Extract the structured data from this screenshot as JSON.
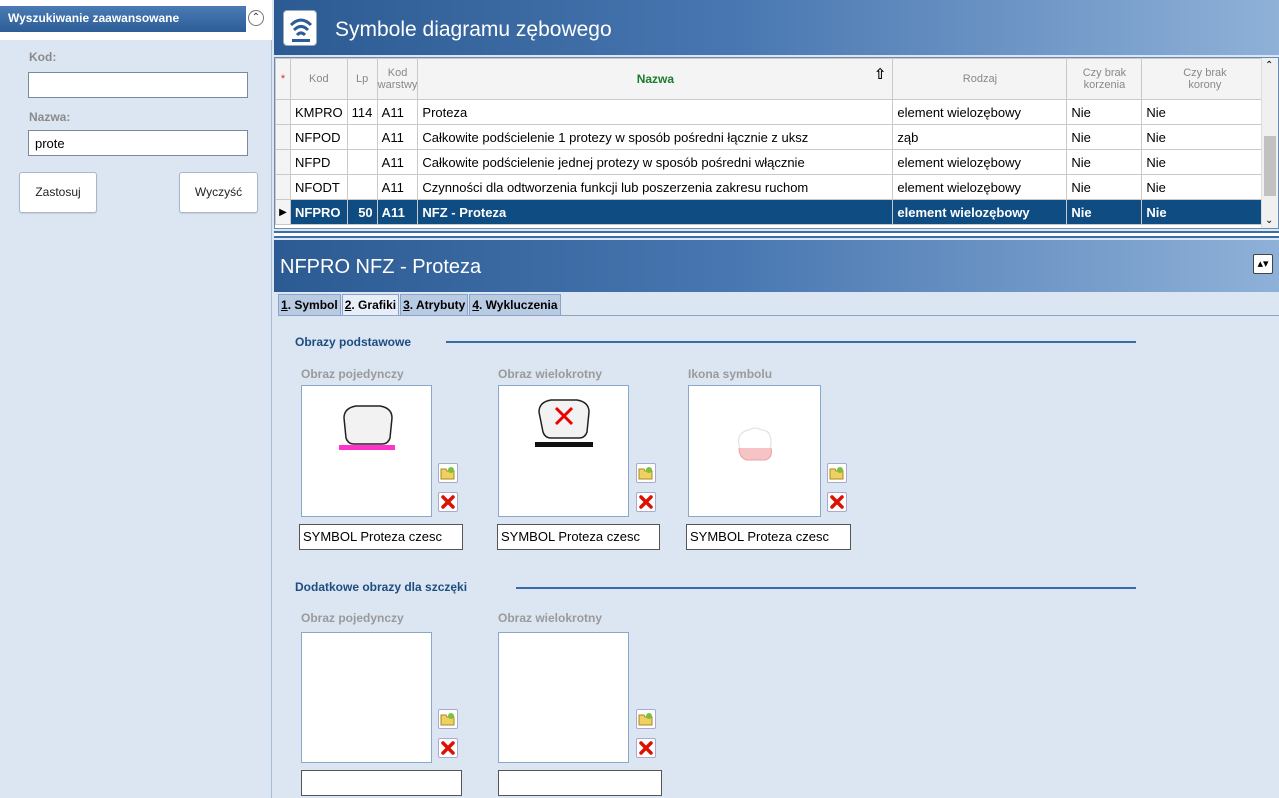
{
  "left": {
    "title": "Wyszukiwanie zaawansowane",
    "kod_label": "Kod:",
    "kod_value": "",
    "nazwa_label": "Nazwa:",
    "nazwa_value": "prote",
    "apply_label": "Zastosuj",
    "clear_label": "Wyczyść"
  },
  "header": {
    "title": "Symbole diagramu zębowego"
  },
  "grid": {
    "columns": {
      "kod": "Kod",
      "lp": "Lp",
      "kod_warstwy_1": "Kod",
      "kod_warstwy_2": "warstwy",
      "nazwa": "Nazwa",
      "rodzaj": "Rodzaj",
      "korzenia_1": "Czy brak",
      "korzenia_2": "korzenia",
      "korony_1": "Czy brak",
      "korony_2": "korony"
    },
    "rows": [
      {
        "kod": "KMPRO",
        "lp": "114",
        "warstwa": "A11",
        "nazwa": "Proteza",
        "rodzaj": "element wielozębowy",
        "korzenia": "Nie",
        "korony": "Nie"
      },
      {
        "kod": "NFPOD",
        "lp": "",
        "warstwa": "A11",
        "nazwa": "Całkowite podścielenie 1 protezy w sposób pośredni łącznie z uksz",
        "rodzaj": "ząb",
        "korzenia": "Nie",
        "korony": "Nie"
      },
      {
        "kod": "NFPD",
        "lp": "",
        "warstwa": "A11",
        "nazwa": "Całkowite podścielenie jednej protezy w sposób pośredni włącznie",
        "rodzaj": "element wielozębowy",
        "korzenia": "Nie",
        "korony": "Nie"
      },
      {
        "kod": "NFODT",
        "lp": "",
        "warstwa": "A11",
        "nazwa": "Czynności dla odtworzenia funkcji lub poszerzenia zakresu ruchom",
        "rodzaj": "element wielozębowy",
        "korzenia": "Nie",
        "korony": "Nie"
      },
      {
        "kod": "NFPRO",
        "lp": "50",
        "warstwa": "A11",
        "nazwa": "NFZ - Proteza",
        "rodzaj": "element wielozębowy",
        "korzenia": "Nie",
        "korony": "Nie"
      }
    ]
  },
  "detail": {
    "title": "NFPRO NFZ - Proteza",
    "tabs": [
      {
        "num": "1",
        "label": ". Symbol"
      },
      {
        "num": "2",
        "label": ". Grafiki"
      },
      {
        "num": "3",
        "label": ". Atrybuty"
      },
      {
        "num": "4",
        "label": ". Wykluczenia"
      }
    ],
    "section1": "Obrazy podstawowe",
    "section2": "Dodatkowe obrazy dla szczęki",
    "img_single": "Obraz pojedynczy",
    "img_multi": "Obraz wielokrotny",
    "img_icon": "Ikona symbolu",
    "file1": "SYMBOL Proteza czesc",
    "file2": "SYMBOL Proteza czesc",
    "file3": "SYMBOL Proteza czesc",
    "file4": "",
    "file5": ""
  },
  "colors": {
    "accent": "#2c5a92",
    "selection": "#0f4c82",
    "sort_header": "#1b7b2e"
  }
}
